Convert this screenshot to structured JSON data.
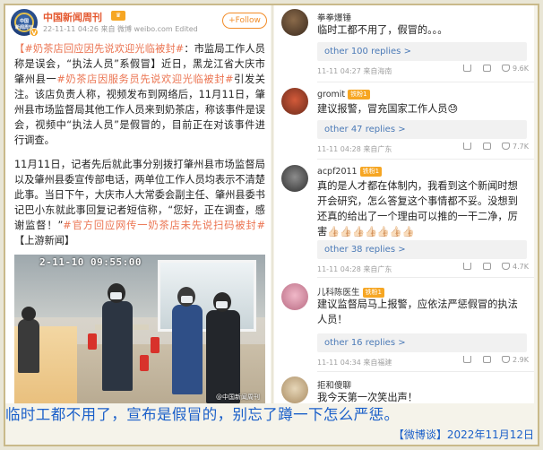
{
  "post": {
    "account_name": "中国新闻周刊",
    "account_badge": "Ⅴ",
    "avatar_text_1": "中国",
    "avatar_text_2": "新闻周刊",
    "meta": "22-11-11 04:26 来自 微博 weibo.com Edited",
    "follow_label": "+Follow",
    "para1_topic1": "【#奶茶店回应因先说欢迎光临被封#",
    "para1_text1": "：市监局工作人员称是误会，“执法人员”系假冒】近日，黑龙江省大庆市肇州县一",
    "para1_topic2": "#奶茶店因服务员先说欢迎光临被封#",
    "para1_text2": "引发关注。该店负责人称，视频发布到网络后，11月11日，肇州县市场监督局其他工作人员来到奶茶店，称该事件是误会，视频中“执法人员”是假冒的，目前正在对该事件进行调查。",
    "para2_text1": "11月11日，记者先后就此事分别拨打肇州县市场监督局以及肇州县委宣传部电话，两单位工作人员均表示不清楚此事。当日下午，大庆市人大常委会副主任、肇州县委书记巴小东就此事回复记者短信称，“您好，正在调查，感谢监督！”",
    "para2_topic": "#官方回应网传一奶茶店未先说扫码被封#",
    "para2_tail": "【上游新闻】",
    "photo_timestamp": "2-11-10 09:55:00",
    "photo_watermark": "@中国新闻周刊"
  },
  "comments": [
    {
      "name": "拳拳爆锤",
      "badge": "",
      "text": "临时工都不用了，假冒的。。。",
      "more": "other 100 replies >",
      "meta": "11-11 04:27 来自海南",
      "likes": "9.6K"
    },
    {
      "name": "gromit",
      "badge": "铁粉1",
      "text": "建议报警，冒充国家工作人员😓",
      "more": "other 47 replies >",
      "meta": "11-11 04:28 来自广东",
      "likes": "7.7K"
    },
    {
      "name": "acpf2011",
      "badge": "铁粉1",
      "text": "真的是人才都在体制内，我看到这个新闻时想开会研究，怎么答复这个事情都不妥。没想到还真的给出了一个理由可以推的一干二净，厉害👍🏻👍🏻👍🏻👍🏻👍🏻👍🏻👍🏻",
      "more": "other 38 replies >",
      "meta": "11-11 04:28 来自广东",
      "likes": "4.7K"
    },
    {
      "name": "儿科陈医生",
      "badge": "铁粉1",
      "text": "建议监督局马上报警，应依法严惩假冒的执法人员！",
      "more": "other 16 replies >",
      "meta": "11-11 04:34 来自福建",
      "likes": "2.9K"
    },
    {
      "name": "拒和傻聊",
      "badge": "",
      "text": "我今天第一次笑出声！",
      "more": "",
      "meta": "",
      "likes": ""
    }
  ],
  "caption": "临时工都不用了，宣布是假冒的，别忘了蹲一下怎么严惩。",
  "signature": "【微博谈】2022年11月12日",
  "colors": {
    "caption_blue": "#1a5fc9",
    "topic_orange": "#eb7350",
    "link_blue": "#4b7ab7",
    "frame_gold": "#c9b98a"
  }
}
